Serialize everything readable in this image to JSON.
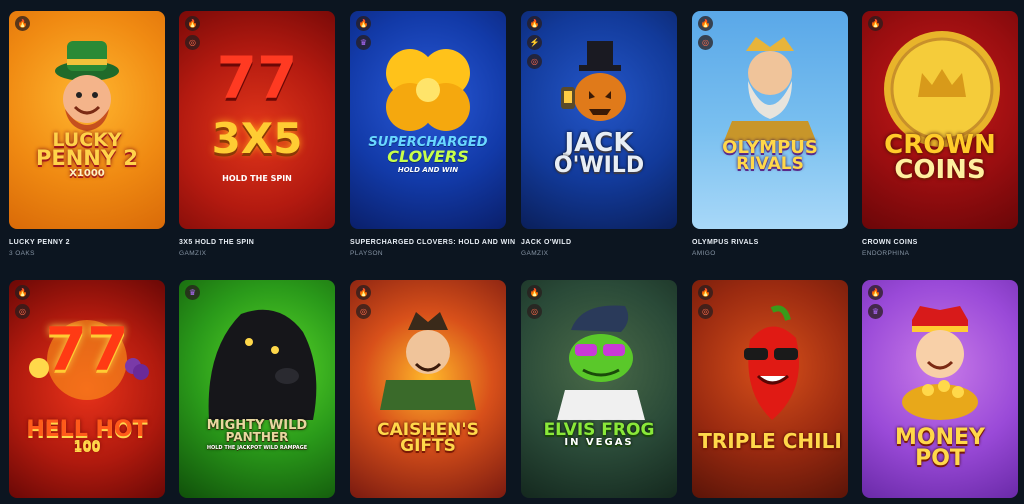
{
  "games": [
    {
      "title": "LUCKY PENNY 2",
      "provider": "3 OAKS",
      "logo": [
        "LUCKY",
        "PENNY 2",
        "X1000"
      ],
      "badges": [
        "fire-icon"
      ]
    },
    {
      "title": "3X5 HOLD THE SPIN",
      "provider": "GAMZIX",
      "logo": [
        "3X5",
        "HOLD THE SPIN"
      ],
      "badges": [
        "fire-icon",
        "multiplier-icon"
      ]
    },
    {
      "title": "SUPERCHARGED CLOVERS: HOLD AND WIN",
      "provider": "PLAYSON",
      "logo": [
        "SUPERCHARGED",
        "CLOVERS",
        "HOLD AND WIN"
      ],
      "badges": [
        "fire-icon",
        "crown-icon"
      ]
    },
    {
      "title": "JACK O'WILD",
      "provider": "GAMZIX",
      "logo": [
        "JACK",
        "O'WILD"
      ],
      "badges": [
        "fire-icon",
        "lightning-icon",
        "multiplier-icon"
      ]
    },
    {
      "title": "OLYMPUS RIVALS",
      "provider": "AMIGO",
      "logo": [
        "OLYMPUS",
        "RIVALS"
      ],
      "badges": [
        "fire-icon",
        "multiplier-icon"
      ]
    },
    {
      "title": "CROWN COINS",
      "provider": "ENDORPHINA",
      "logo": [
        "CROWN",
        "COINS"
      ],
      "badges": [
        "fire-icon"
      ]
    },
    {
      "title": "",
      "provider": "",
      "logo": [
        "HELL HOT",
        "100"
      ],
      "badges": [
        "fire-icon",
        "multiplier-icon"
      ]
    },
    {
      "title": "",
      "provider": "",
      "logo": [
        "MIGHTY WILD",
        "PANTHER",
        "HOLD THE JACKPOT WILD RAMPAGE"
      ],
      "badges": [
        "crown-icon"
      ]
    },
    {
      "title": "",
      "provider": "",
      "logo": [
        "CAISHEN'S",
        "GIFTS"
      ],
      "badges": [
        "fire-icon",
        "multiplier-icon"
      ]
    },
    {
      "title": "",
      "provider": "",
      "logo": [
        "ELVIS FROG",
        "IN VEGAS"
      ],
      "badges": [
        "fire-icon",
        "multiplier-icon"
      ]
    },
    {
      "title": "",
      "provider": "",
      "logo": [
        "TRIPLE CHILI"
      ],
      "badges": [
        "fire-icon",
        "multiplier-icon"
      ]
    },
    {
      "title": "",
      "provider": "",
      "logo": [
        "MONEY",
        "POT"
      ],
      "badges": [
        "fire-icon",
        "crown-icon"
      ]
    }
  ],
  "icons": {
    "fire-icon": "🔥",
    "multiplier-icon": "◎",
    "crown-icon": "♛",
    "lightning-icon": "⚡"
  }
}
